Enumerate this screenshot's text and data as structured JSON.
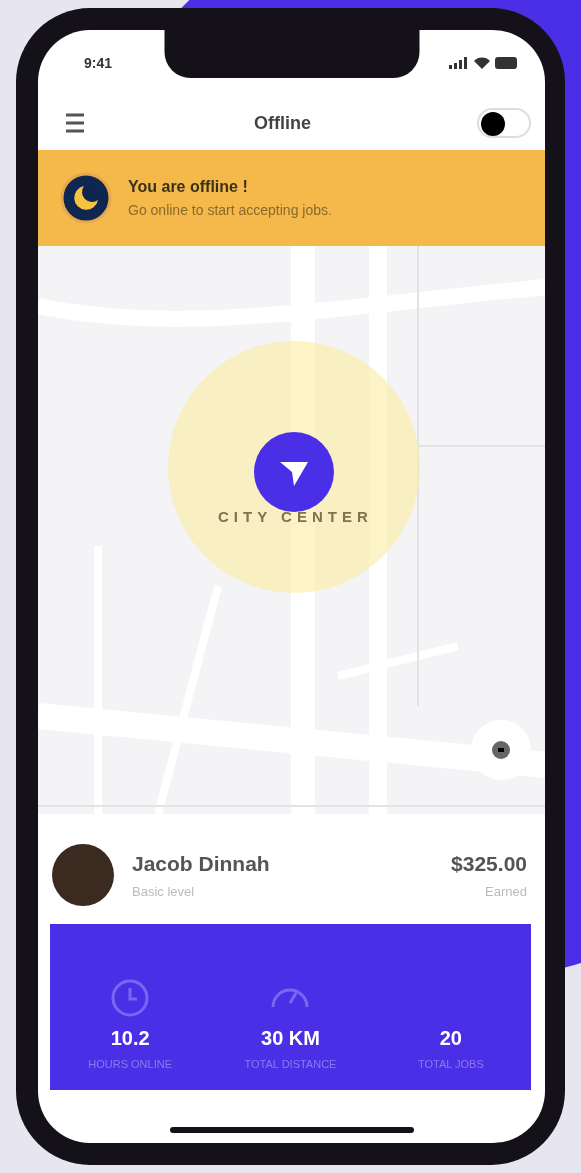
{
  "status_bar": {
    "time": "9:41"
  },
  "header": {
    "title": "Offline",
    "online": false
  },
  "banner": {
    "title": "You are offline !",
    "subtitle": "Go online to start accepting jobs."
  },
  "map": {
    "area_label": "CITY CENTER"
  },
  "driver": {
    "name": "Jacob Dinnah",
    "level": "Basic level",
    "amount": "$325.00",
    "amount_label": "Earned"
  },
  "stats": [
    {
      "kind": "clock",
      "value": "10.2",
      "label": "HOURS ONLINE"
    },
    {
      "kind": "gauge",
      "value": "30 KM",
      "label": "TOTAL DISTANCE"
    },
    {
      "kind": "none",
      "value": "20",
      "label": "TOTAL JOBS"
    }
  ]
}
